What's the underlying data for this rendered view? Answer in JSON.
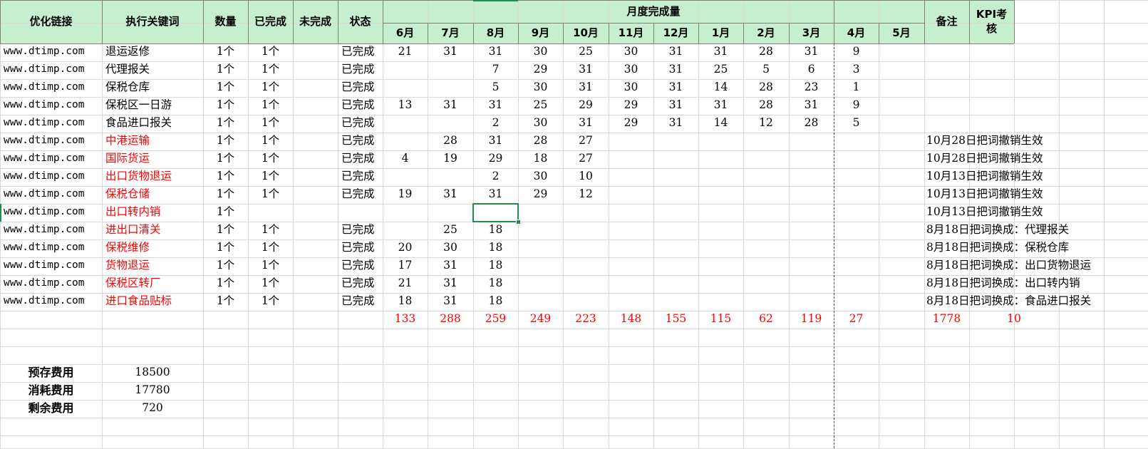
{
  "header": {
    "link": "优化链接",
    "keyword": "执行关键词",
    "qty": "数量",
    "done": "已完成",
    "undone": "未完成",
    "status": "状态",
    "monthly": "月度完成量",
    "months": [
      "6月",
      "7月",
      "8月",
      "9月",
      "10月",
      "11月",
      "12月",
      "1月",
      "2月",
      "3月",
      "4月",
      "5月"
    ],
    "note": "备注",
    "kpi_line1": "KPI考",
    "kpi_line2": "核"
  },
  "rows": [
    {
      "url": "www.dtimp.com",
      "keyword": "退运返修",
      "red": false,
      "qty": "1个",
      "done": "1个",
      "status": "已完成",
      "m": [
        "21",
        "31",
        "31",
        "30",
        "25",
        "30",
        "31",
        "31",
        "28",
        "31",
        "9",
        ""
      ],
      "note": ""
    },
    {
      "url": "www.dtimp.com",
      "keyword": "代理报关",
      "red": false,
      "qty": "1个",
      "done": "1个",
      "status": "已完成",
      "m": [
        "",
        "",
        "7",
        "29",
        "31",
        "30",
        "31",
        "25",
        "5",
        "6",
        "3",
        ""
      ],
      "note": ""
    },
    {
      "url": "www.dtimp.com",
      "keyword": "保税仓库",
      "red": false,
      "qty": "1个",
      "done": "1个",
      "status": "已完成",
      "m": [
        "",
        "",
        "5",
        "30",
        "31",
        "30",
        "31",
        "14",
        "28",
        "23",
        "1",
        ""
      ],
      "note": ""
    },
    {
      "url": "www.dtimp.com",
      "keyword": "保税区一日游",
      "red": false,
      "qty": "1个",
      "done": "1个",
      "status": "已完成",
      "m": [
        "13",
        "31",
        "31",
        "25",
        "29",
        "29",
        "31",
        "31",
        "28",
        "31",
        "9",
        ""
      ],
      "note": ""
    },
    {
      "url": "www.dtimp.com",
      "keyword": "食品进口报关",
      "red": false,
      "qty": "1个",
      "done": "1个",
      "status": "已完成",
      "m": [
        "",
        "",
        "2",
        "30",
        "31",
        "29",
        "31",
        "14",
        "12",
        "28",
        "5",
        ""
      ],
      "note": ""
    },
    {
      "url": "www.dtimp.com",
      "keyword": "中港运输",
      "red": true,
      "qty": "1个",
      "done": "1个",
      "status": "已完成",
      "m": [
        "",
        "28",
        "31",
        "28",
        "27",
        "",
        "",
        "",
        "",
        "",
        "",
        ""
      ],
      "note": "10月28日把词撤销生效"
    },
    {
      "url": "www.dtimp.com",
      "keyword": "国际货运",
      "red": true,
      "qty": "1个",
      "done": "1个",
      "status": "已完成",
      "m": [
        "4",
        "19",
        "29",
        "18",
        "27",
        "",
        "",
        "",
        "",
        "",
        "",
        ""
      ],
      "note": "10月28日把词撤销生效"
    },
    {
      "url": "www.dtimp.com",
      "keyword": "出口货物退运",
      "red": true,
      "qty": "1个",
      "done": "1个",
      "status": "已完成",
      "m": [
        "",
        "",
        "2",
        "30",
        "10",
        "",
        "",
        "",
        "",
        "",
        "",
        ""
      ],
      "note": "10月13日把词撤销生效"
    },
    {
      "url": "www.dtimp.com",
      "keyword": "保税仓储",
      "red": true,
      "qty": "1个",
      "done": "1个",
      "status": "已完成",
      "m": [
        "19",
        "31",
        "31",
        "29",
        "12",
        "",
        "",
        "",
        "",
        "",
        "",
        ""
      ],
      "note": "10月13日把词撤销生效"
    },
    {
      "url": "www.dtimp.com",
      "keyword": "出口转内销",
      "red": true,
      "qty": "1个",
      "done": "",
      "status": "",
      "m": [
        "",
        "",
        "",
        "",
        "",
        "",
        "",
        "",
        "",
        "",
        "",
        ""
      ],
      "note": "10月13日把词撤销生效"
    },
    {
      "url": "www.dtimp.com",
      "keyword": "进出口清关",
      "red": true,
      "qty": "1个",
      "done": "1个",
      "status": "已完成",
      "m": [
        "",
        "25",
        "18",
        "",
        "",
        "",
        "",
        "",
        "",
        "",
        "",
        ""
      ],
      "note": "8月18日把词换成：代理报关"
    },
    {
      "url": "www.dtimp.com",
      "keyword": "保税维修",
      "red": true,
      "qty": "1个",
      "done": "1个",
      "status": "已完成",
      "m": [
        "20",
        "30",
        "18",
        "",
        "",
        "",
        "",
        "",
        "",
        "",
        "",
        ""
      ],
      "note": "8月18日把词换成：保税仓库"
    },
    {
      "url": "www.dtimp.com",
      "keyword": "货物退运",
      "red": true,
      "qty": "1个",
      "done": "1个",
      "status": "已完成",
      "m": [
        "17",
        "31",
        "18",
        "",
        "",
        "",
        "",
        "",
        "",
        "",
        "",
        ""
      ],
      "note": "8月18日把词换成：出口货物退运"
    },
    {
      "url": "www.dtimp.com",
      "keyword": "保税区转厂",
      "red": true,
      "qty": "1个",
      "done": "1个",
      "status": "已完成",
      "m": [
        "21",
        "31",
        "18",
        "",
        "",
        "",
        "",
        "",
        "",
        "",
        "",
        ""
      ],
      "note": "8月18日把词换成：出口转内销"
    },
    {
      "url": "www.dtimp.com",
      "keyword": "进口食品贴标",
      "red": true,
      "qty": "1个",
      "done": "1个",
      "status": "已完成",
      "m": [
        "18",
        "31",
        "18",
        "",
        "",
        "",
        "",
        "",
        "",
        "",
        "",
        ""
      ],
      "note": "8月18日把词换成：食品进口报关"
    }
  ],
  "totals": {
    "months": [
      "133",
      "288",
      "259",
      "249",
      "223",
      "148",
      "155",
      "115",
      "62",
      "119",
      "27",
      ""
    ],
    "note_total": "1778",
    "kpi": "10"
  },
  "fees": [
    {
      "label": "预存费用",
      "value": "18500"
    },
    {
      "label": "消耗费用",
      "value": "17780"
    },
    {
      "label": "剩余费用",
      "value": "720"
    }
  ],
  "colors": {
    "header_fill": "#c6efce",
    "gridline": "#d9d9d9",
    "selection": "#1e8f4e",
    "red_text": "#ff0000"
  }
}
